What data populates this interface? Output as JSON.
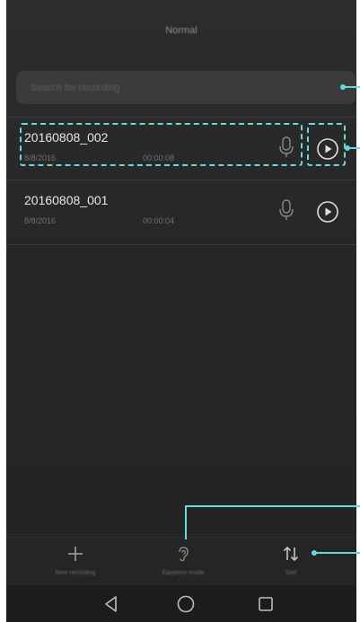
{
  "header": {
    "title": "Normal"
  },
  "search": {
    "placeholder": "Search for recording"
  },
  "recordings": [
    {
      "name": "20160808_002",
      "date": "8/8/2016",
      "duration": "00:00:08"
    },
    {
      "name": "20160808_001",
      "date": "8/8/2016",
      "duration": "00:00:04"
    }
  ],
  "toolbar": {
    "new_recording_label": "New recording",
    "earpiece_mode_label": "Earpiece mode",
    "sort_label": "Sort"
  },
  "colors": {
    "callout": "#6ad7d9",
    "background": "#282828"
  },
  "icons": [
    "mic-icon",
    "play-icon",
    "plus-icon",
    "ear-icon",
    "sort-icon",
    "back-icon",
    "home-icon",
    "recents-icon"
  ]
}
